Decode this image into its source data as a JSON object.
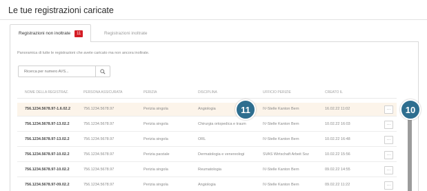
{
  "page": {
    "title": "Le tue registrazioni caricate"
  },
  "tabs": [
    {
      "label": "Registrazioni non inoltrate",
      "badge": "11",
      "active": true
    },
    {
      "label": "Registrazioni inoltrate",
      "active": false
    }
  ],
  "panel": {
    "description": "Panoramica di tutte le registrazioni che avete caricato ma non ancora inoltrate."
  },
  "search": {
    "placeholder": "Ricerca per numero AVS..."
  },
  "table": {
    "columns": [
      "NOME DELLA REGISTRAZ.",
      "PERSONA ASSICURATA",
      "PERIZIA",
      "DISCIPLINA",
      "UFFICIO PERIZIE",
      "CREATO IL"
    ],
    "rows": [
      {
        "name": "756.1234.5678.97-1.6.02.2",
        "person": "756.1234.5678.97",
        "perizia": "Perizia singola",
        "disciplina": "Angiologia",
        "ufficio": "IV-Stelle Kanton Bern",
        "created": "16.02.22 11:02",
        "highlight": true
      },
      {
        "name": "756.1234.5678.97-13.02.2",
        "person": "756.1234.5678.97",
        "perizia": "Perizia singola",
        "disciplina": "Chirurgia ortopedica e traum",
        "ufficio": "IV-Stelle Kanton Bern",
        "created": "10.02.22 16:03",
        "highlight": false
      },
      {
        "name": "756.1234.5678.97-13.02.2",
        "person": "756.1234.5678.97",
        "perizia": "Perizia singola",
        "disciplina": "ORL",
        "ufficio": "IV-Stelle Kanton Bern",
        "created": "10.02.22 16:48",
        "highlight": false
      },
      {
        "name": "756.1234.5678.97-10.02.2",
        "person": "756.1234.5678.97",
        "perizia": "Perizia parziale",
        "disciplina": "Dermatologia e venereologi",
        "ufficio": "SVAS Wirtschaft Arbeit Soz",
        "created": "10.02.22 15:56",
        "highlight": false
      },
      {
        "name": "756.1234.5678.97-10.02.2",
        "person": "756.1234.5678.97",
        "perizia": "Perizia singola",
        "disciplina": "Reumatologia",
        "ufficio": "IV-Stelle Kanton Bern",
        "created": "09.02.22 14:55",
        "highlight": false
      },
      {
        "name": "756.1234.5678.97-09.02.2",
        "person": "756.1234.5678.97",
        "perizia": "Perizia singola",
        "disciplina": "Angiologia",
        "ufficio": "IV-Stelle Kanton Bern",
        "created": "09.02.22 11:22",
        "highlight": false
      }
    ],
    "more_label": "···"
  },
  "markers": [
    {
      "label": "11"
    },
    {
      "label": "10"
    }
  ],
  "colors": {
    "badge": "#d41c24",
    "highlight_row": "#fcf4ea",
    "marker": "#2e6e8f"
  },
  "icons": {
    "search_button": "search-icon",
    "row_action": "more-icon"
  }
}
